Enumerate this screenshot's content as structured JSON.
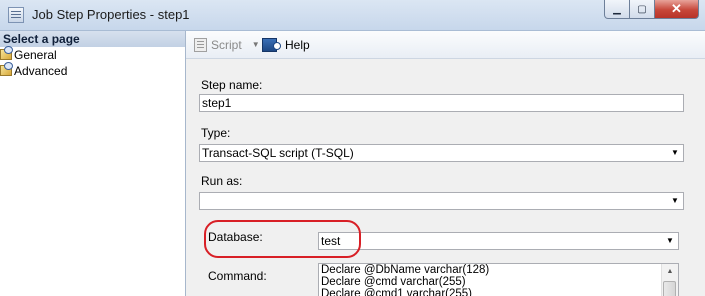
{
  "window": {
    "title": "Job Step Properties - step1",
    "min_glyph": "▁",
    "max_glyph": "▢",
    "close_glyph": "✕"
  },
  "left_pane": {
    "header": "Select a page",
    "items": [
      {
        "label": "General",
        "icon": "properties-page-icon"
      },
      {
        "label": "Advanced",
        "icon": "properties-page-icon"
      }
    ]
  },
  "toolbar": {
    "script_label": "Script",
    "script_arrow": "▼",
    "help_label": "Help"
  },
  "form": {
    "step_name_label": "Step name:",
    "step_name_value": "step1",
    "type_label": "Type:",
    "type_value": "Transact-SQL script (T-SQL)",
    "run_as_label": "Run as:",
    "run_as_value": "",
    "database_label": "Database:",
    "database_value": "test",
    "command_label": "Command:",
    "command_lines": [
      "Declare @DbName varchar(128)",
      "Declare @cmd varchar(255)",
      "Declare @cmd1 varchar(255)"
    ],
    "combo_arrow": "▼",
    "scroll_up": "▲"
  },
  "colors": {
    "highlight": "#d81f26",
    "title_bar": "#c7d7eb",
    "close_button": "#c7473a"
  }
}
